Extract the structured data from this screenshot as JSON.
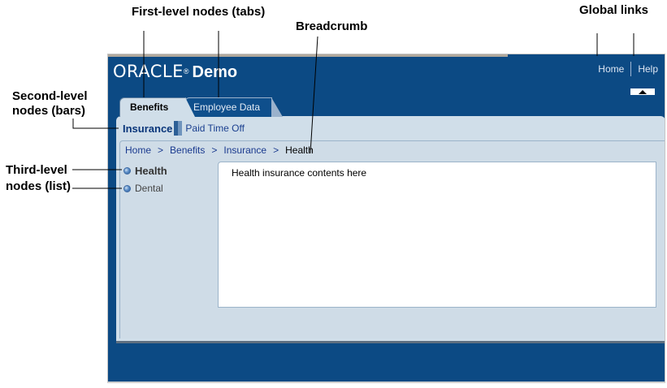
{
  "callouts": {
    "tabs": "First-level nodes (tabs)",
    "breadcrumb": "Breadcrumb",
    "global_links": "Global links",
    "bars_line1": "Second-level",
    "bars_line2": "nodes (bars)",
    "list_line1": "Third-level",
    "list_line2": "nodes (list)"
  },
  "app": {
    "brand": "ORACLE",
    "brand_mark": "®",
    "product": "Demo",
    "global_links": [
      "Home",
      "Help"
    ],
    "collapse_icon": "triangle-up-icon"
  },
  "tabs": [
    {
      "label": "Benefits",
      "selected": true
    },
    {
      "label": "Employee Data",
      "selected": false
    }
  ],
  "bars": [
    {
      "label": "Insurance",
      "selected": true
    },
    {
      "label": "Paid Time Off",
      "selected": false
    }
  ],
  "breadcrumb": {
    "items": [
      "Home",
      "Benefits",
      "Insurance"
    ],
    "separator": ">",
    "current": "Health"
  },
  "list": [
    {
      "label": "Health",
      "selected": true,
      "icon": "bullet-dot-icon"
    },
    {
      "label": "Dental",
      "selected": false,
      "icon": "bullet-dot-icon"
    }
  ],
  "content": {
    "text": "Health insurance contents here"
  },
  "colors": {
    "frame": "#0c4a84",
    "panel": "#d0dee9",
    "link": "#1a3a8f"
  }
}
